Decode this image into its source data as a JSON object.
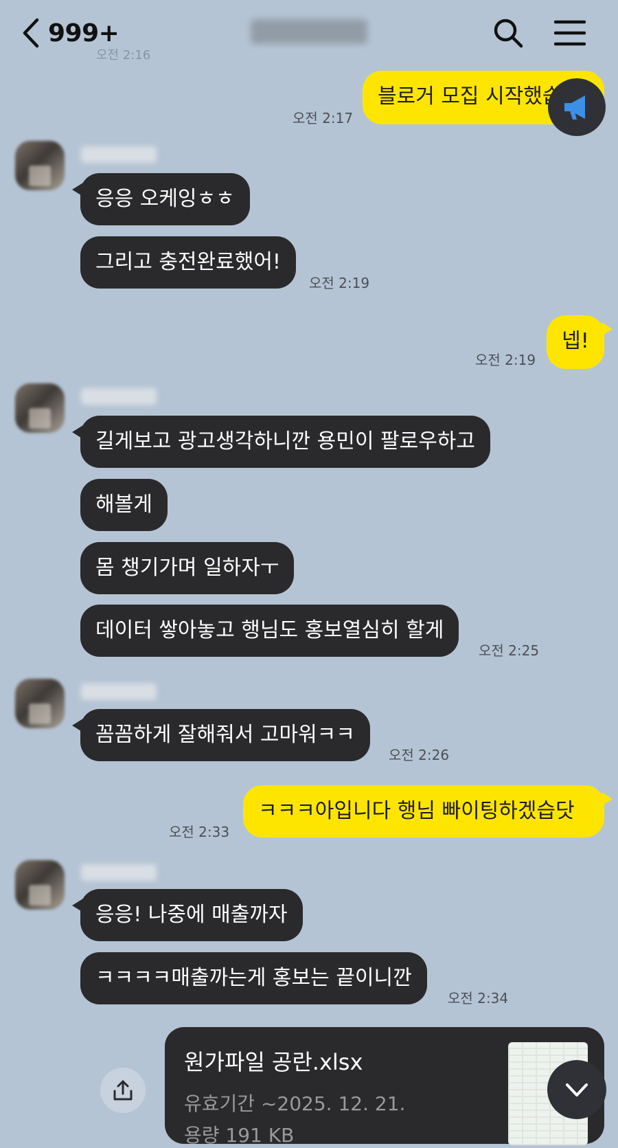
{
  "header": {
    "back_count": "999+",
    "ghost_time": "오전 2:16"
  },
  "messages": [
    {
      "text": "블로거 모집 시작했습니다",
      "time": "오전 2:17",
      "from": "me"
    },
    {
      "text": "응응 오케잉ㅎㅎ",
      "from": "them"
    },
    {
      "text": "그리고 충전완료했어!",
      "time": "오전 2:19",
      "from": "them"
    },
    {
      "text": "넵!",
      "time": "오전 2:19",
      "from": "me"
    },
    {
      "text": "길게보고 광고생각하니깐 용민이 팔로우하고",
      "from": "them"
    },
    {
      "text": "해볼게",
      "from": "them"
    },
    {
      "text": "몸 챙기가며 일하자ㅜ",
      "from": "them"
    },
    {
      "text": "데이터 쌓아놓고 행님도 홍보열심히 할게",
      "time": "오전 2:25",
      "from": "them"
    },
    {
      "text": "꼼꼼하게 잘해줘서 고마워ㅋㅋ",
      "time": "오전 2:26",
      "from": "them"
    },
    {
      "text": "ㅋㅋㅋ아입니다 행님 빠이팅하겠습닷",
      "time": "오전 2:33",
      "from": "me"
    },
    {
      "text": "응응!  나중에 매출까자",
      "from": "them"
    },
    {
      "text": "ㅋㅋㅋㅋ매출까는게 홍보는 끝이니깐",
      "time": "오전 2:34",
      "from": "them"
    }
  ],
  "file": {
    "name": "원가파일 공란.xlsx",
    "expiry": "유효기간  ~2025. 12. 21.",
    "size": "용량  191 KB"
  },
  "colors": {
    "background": "#b5c4d4",
    "my_bubble": "#fee500",
    "their_bubble": "#2a2a2c",
    "notice_accent": "#3d8fe6"
  },
  "icons": [
    "back-chevron-icon",
    "search-icon",
    "menu-icon",
    "megaphone-icon",
    "share-icon",
    "chevron-down-icon"
  ]
}
